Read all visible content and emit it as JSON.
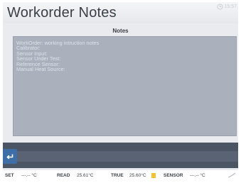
{
  "window": {
    "title": "Workorder Notes",
    "clock": "15:57"
  },
  "notes": {
    "header": "Notes",
    "lines": [
      "WorkOrder: working intruction notes",
      "Calibrator:",
      "Sensor Input:",
      "Sensor Under Test:",
      "Reference Sensor:",
      "Manual Heat Source:"
    ]
  },
  "icons": {
    "back": "back-arrow-icon",
    "clock": "clock-icon",
    "status_end": "swipe-icon"
  },
  "status_bar": {
    "set_label": "SET",
    "set_value": "---.-- °C",
    "read_label": "READ",
    "read_value": "25.61°C",
    "true_label": "TRUE",
    "true_value": "25.60°C",
    "sensor_label": "SENSOR",
    "sensor_value": "---.-- °C"
  },
  "colors": {
    "panel": "#aab0bc",
    "back_button": "#3d6ea6",
    "true_indicator": "#f2c230"
  }
}
